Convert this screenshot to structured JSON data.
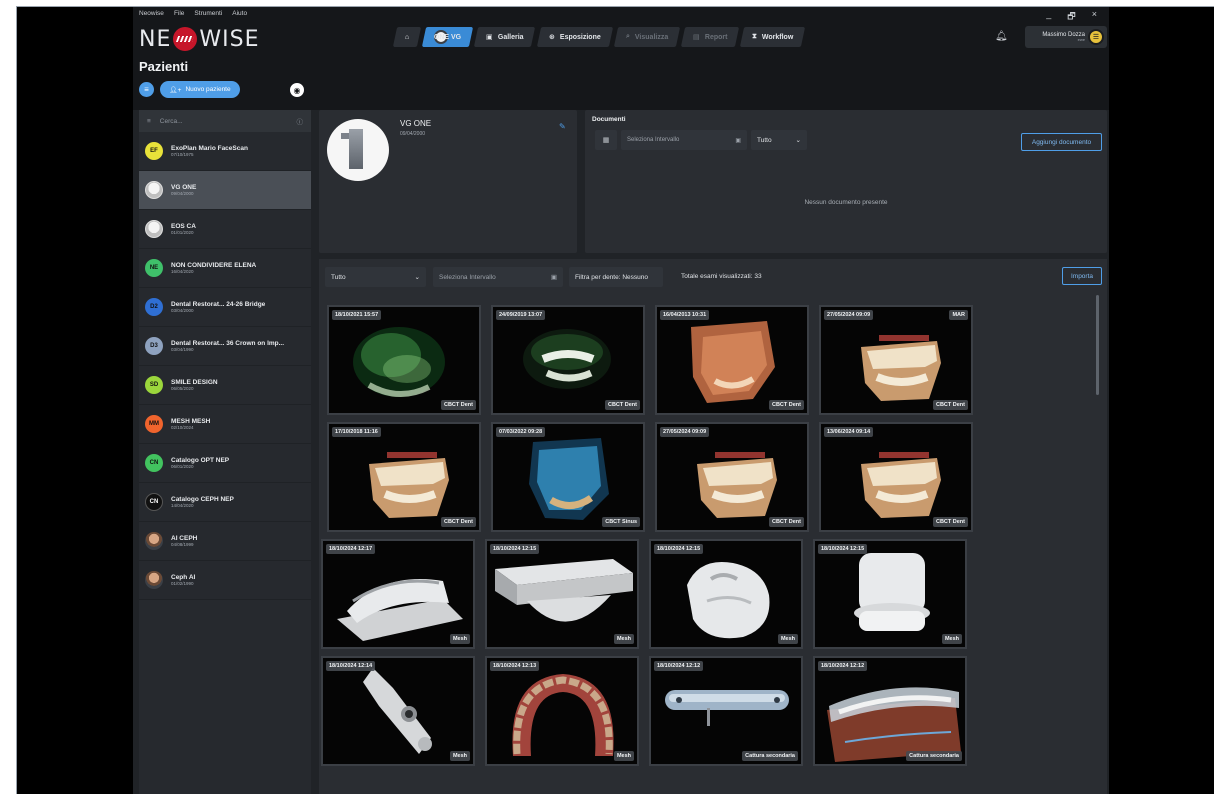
{
  "menu": [
    "Neowise",
    "File",
    "Strumenti",
    "Aiuto"
  ],
  "window_controls": [
    "_",
    "🗗",
    "×"
  ],
  "brand": {
    "left": "NE",
    "right": "WISE"
  },
  "nav": {
    "home_icon": "home-icon",
    "tabs": [
      {
        "label": "ONE VG",
        "active": true
      },
      {
        "label": "Galleria"
      },
      {
        "label": "Esposizione"
      },
      {
        "label": "Visualizza",
        "disabled": true
      },
      {
        "label": "Report",
        "disabled": true
      },
      {
        "label": "Workflow"
      }
    ]
  },
  "user": {
    "name": "Massimo Dozza",
    "role": "ewe"
  },
  "page_title": "Pazienti",
  "new_patient_label": "Nuovo paziente",
  "search_placeholder": "Cerca...",
  "patients": [
    {
      "initials": "EF",
      "name": "ExoPlan Mario FaceScan",
      "date": "07/10/1975",
      "color": "#e8e23a"
    },
    {
      "initials": "",
      "name": "VG ONE",
      "date": "09/04/2000",
      "photo": true,
      "selected": true
    },
    {
      "initials": "",
      "name": "EOS CA",
      "date": "01/01/2020",
      "photo": true
    },
    {
      "initials": "NE",
      "name": "NON CONDIVIDERE ELENA",
      "date": "16/04/2020",
      "color": "#3fc06a"
    },
    {
      "initials": "D2",
      "name": "Dental Restorat... 24-26 Bridge",
      "date": "03/04/2000",
      "color": "#2f6fd3"
    },
    {
      "initials": "D3",
      "name": "Dental Restorat... 36 Crown on Imp...",
      "date": "03/04/1990",
      "color": "#8ea2bf"
    },
    {
      "initials": "SD",
      "name": "SMILE DESIGN",
      "date": "06/05/2020",
      "color": "#9bd63c"
    },
    {
      "initials": "MM",
      "name": "MESH MESH",
      "date": "02/10/2024",
      "color": "#f0642d"
    },
    {
      "initials": "CN",
      "name": "Catalogo OPT NEP",
      "date": "06/01/2020",
      "color": "#42c35f"
    },
    {
      "initials": "CN",
      "name": "Catalogo CEPH NEP",
      "date": "14/04/2020",
      "color": "#111111",
      "light": true
    },
    {
      "initials": "",
      "name": "AI CEPH",
      "date": "04/08/1999",
      "face": true
    },
    {
      "initials": "",
      "name": "Ceph AI",
      "date": "01/02/1990",
      "face": true
    }
  ],
  "selected_patient": {
    "name": "VG ONE",
    "date": "09/04/2000"
  },
  "documents": {
    "title": "Documenti",
    "range_placeholder": "Seleziona Intervallo",
    "type": "Tutto",
    "add_label": "Aggiungi documento",
    "empty": "Nessun documento presente"
  },
  "filters": {
    "type": "Tutto",
    "range_placeholder": "Seleziona Intervallo",
    "tooth_filter": "Filtra per dente: Nessuno",
    "total": "Totale esami visualizzati: 33",
    "import_label": "Importa"
  },
  "exams": [
    {
      "date": "18/10/2021 15:57",
      "tag": "CBCT Dent",
      "kind": "green"
    },
    {
      "date": "24/09/2019 13:07",
      "tag": "CBCT Dent",
      "kind": "teeth"
    },
    {
      "date": "16/04/2013 10:31",
      "tag": "CBCT Dent",
      "kind": "skull"
    },
    {
      "date": "27/05/2024 09:09",
      "tag": "CBCT Dent",
      "kind": "jaw",
      "mar": "MAR"
    },
    {
      "date": "17/10/2018 11:16",
      "tag": "CBCT Dent",
      "kind": "jaw"
    },
    {
      "date": "07/03/2022 09:28",
      "tag": "CBCT Sinus",
      "kind": "blue"
    },
    {
      "date": "27/05/2024 09:09",
      "tag": "CBCT Dent",
      "kind": "jaw"
    },
    {
      "date": "13/06/2024 09:14",
      "tag": "CBCT Dent",
      "kind": "jaw"
    },
    {
      "date": "18/10/2024 12:17",
      "tag": "Mesh",
      "kind": "mesh-model"
    },
    {
      "date": "18/10/2024 12:15",
      "tag": "Mesh",
      "kind": "mesh-block"
    },
    {
      "date": "18/10/2024 12:15",
      "tag": "Mesh",
      "kind": "mesh-tooth"
    },
    {
      "date": "18/10/2024 12:15",
      "tag": "Mesh",
      "kind": "mesh-crown"
    },
    {
      "date": "18/10/2024 12:14",
      "tag": "Mesh",
      "kind": "mesh-bar"
    },
    {
      "date": "18/10/2024 12:13",
      "tag": "Mesh",
      "kind": "arch"
    },
    {
      "date": "18/10/2024 12:12",
      "tag": "Cattura secondaria",
      "kind": "guide"
    },
    {
      "date": "18/10/2024 12:12",
      "tag": "Cattura secondaria",
      "kind": "denture"
    }
  ]
}
